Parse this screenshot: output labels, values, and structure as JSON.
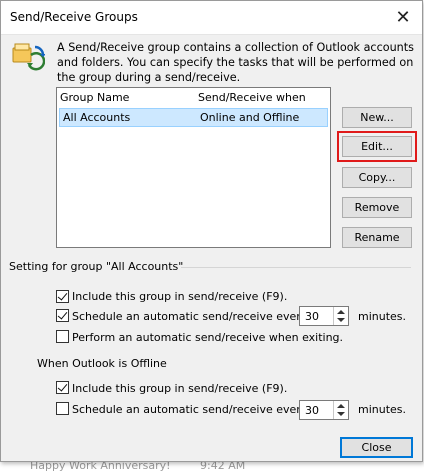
{
  "background": {
    "snippet1": "Happy Work Anniversary!",
    "snippet2": "9:42 AM"
  },
  "dialog": {
    "title": "Send/Receive Groups",
    "close_icon": "close-icon",
    "description": "A Send/Receive group contains a collection of Outlook accounts and folders. You can specify the tasks that will be performed on the group during a send/receive.",
    "list": {
      "headers": {
        "name": "Group Name",
        "when": "Send/Receive when"
      },
      "rows": [
        {
          "name": "All Accounts",
          "when": "Online and Offline",
          "selected": true
        }
      ]
    },
    "buttons": {
      "new": "New...",
      "edit": "Edit...",
      "copy": "Copy...",
      "remove": "Remove",
      "rename": "Rename",
      "close": "Close"
    },
    "setting_label": "Setting for group \"All Accounts\"",
    "online": {
      "include": {
        "label": "Include this group in send/receive (F9).",
        "checked": true
      },
      "schedule": {
        "label": "Schedule an automatic send/receive every",
        "checked": true,
        "value": "30",
        "unit": "minutes."
      },
      "exiting": {
        "label": "Perform an automatic send/receive when exiting.",
        "checked": false
      }
    },
    "offline_label": "When Outlook is Offline",
    "offline": {
      "include": {
        "label": "Include this group in send/receive (F9).",
        "checked": true
      },
      "schedule": {
        "label": "Schedule an automatic send/receive every",
        "checked": false,
        "value": "30",
        "unit": "minutes."
      }
    },
    "accent": "#0078d7",
    "highlight_color": "#e01a1a"
  }
}
